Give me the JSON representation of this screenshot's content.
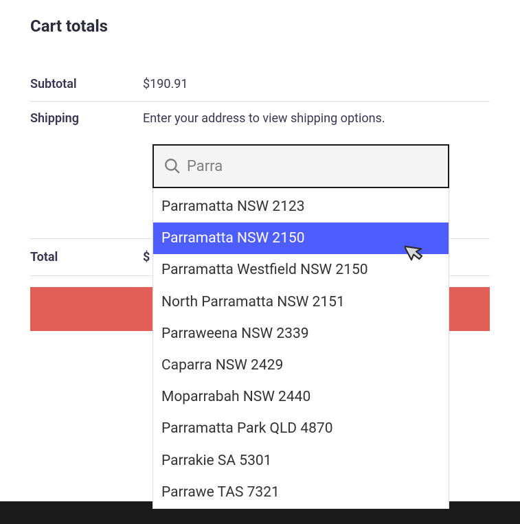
{
  "heading": "Cart totals",
  "subtotal": {
    "label": "Subtotal",
    "value": "$190.91"
  },
  "shipping": {
    "label": "Shipping",
    "message": "Enter your address to view shipping options."
  },
  "total": {
    "label": "Total",
    "value": "$"
  },
  "search": {
    "value": "Parra"
  },
  "dropdown": {
    "items": [
      "Parramatta NSW 2123",
      "Parramatta NSW 2150",
      "Parramatta Westfield NSW 2150",
      "North Parramatta NSW 2151",
      "Parraweena NSW 2339",
      "Caparra NSW 2429",
      "Moparrabah NSW 2440",
      "Parramatta Park QLD 4870",
      "Parrakie SA 5301",
      "Parrawe TAS 7321"
    ],
    "highlightedIndex": 1
  }
}
